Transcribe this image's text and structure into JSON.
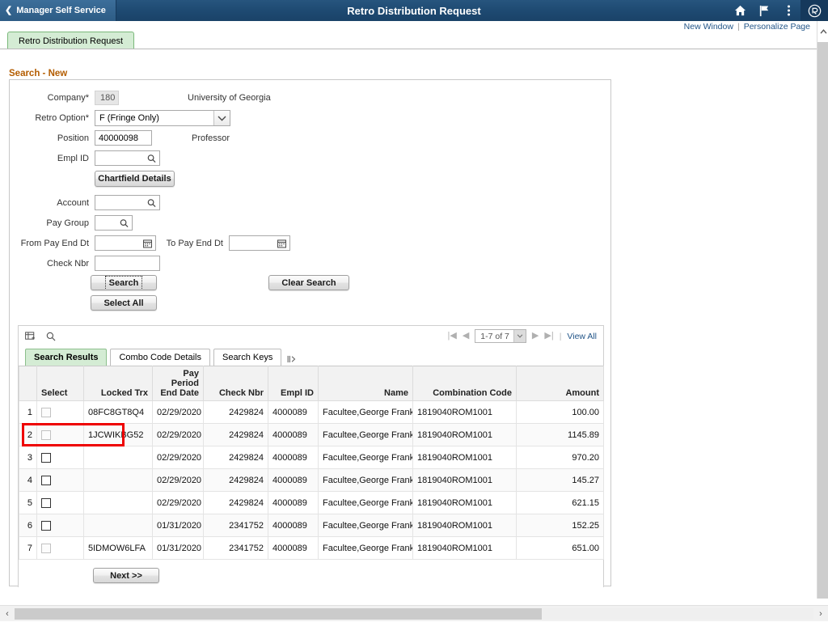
{
  "header": {
    "back_label": "Manager Self Service",
    "title": "Retro Distribution Request",
    "icons": [
      "home-icon",
      "flag-icon",
      "actions-menu-icon",
      "oracle-logo-icon"
    ]
  },
  "links": {
    "new_window": "New Window",
    "separator": "|",
    "personalize_page": "Personalize Page"
  },
  "page_tab": {
    "label": "Retro Distribution Request"
  },
  "section": {
    "title": "Search - New"
  },
  "form": {
    "company": {
      "label": "Company*",
      "value": "180",
      "description": "University of Georgia"
    },
    "retro_option": {
      "label": "Retro Option*",
      "value": "F (Fringe Only)"
    },
    "position": {
      "label": "Position",
      "value": "40000098",
      "description": "Professor"
    },
    "empl_id": {
      "label": "Empl ID",
      "value": ""
    },
    "chartfield_button": {
      "label": "Chartfield Details"
    },
    "account": {
      "label": "Account",
      "value": ""
    },
    "pay_group": {
      "label": "Pay Group",
      "value": ""
    },
    "from_pay_end_dt": {
      "label": "From Pay End Dt",
      "value": ""
    },
    "to_pay_end_dt": {
      "label": "To Pay End Dt",
      "value": ""
    },
    "check_nbr": {
      "label": "Check Nbr",
      "value": ""
    },
    "search_button": {
      "label": "Search"
    },
    "clear_search_button": {
      "label": "Clear Search"
    },
    "select_all_button": {
      "label": "Select All"
    }
  },
  "grid": {
    "toolbar_icons": [
      "personalize-grid-icon",
      "find-icon"
    ],
    "pagination": {
      "first_label": "|◀",
      "prev_label": "◀",
      "range": "1-7 of 7",
      "next_label": "▶",
      "last_label": "▶|",
      "separator": "|",
      "view_all": "View All"
    },
    "tabs": [
      {
        "label": "Search Results",
        "active": true
      },
      {
        "label": "Combo Code Details",
        "active": false
      },
      {
        "label": "Search Keys",
        "active": false
      }
    ],
    "expand_icon": "expand-tabs-icon",
    "columns": [
      "Select",
      "Locked Trx",
      "Pay Period End Date",
      "Check Nbr",
      "Empl ID",
      "Name",
      "Combination Code",
      "Amount"
    ],
    "rows": [
      {
        "num": "1",
        "selected": false,
        "checkbox_enabled": false,
        "locked_trx": "08FC8GT8Q4",
        "pay_period_end_date": "02/29/2020",
        "check_nbr": "2429824",
        "empl_id": "4000089",
        "name": "Facultee,George Frank",
        "combination_code": "1819040ROM1001",
        "amount": "100.00"
      },
      {
        "num": "2",
        "selected": false,
        "checkbox_enabled": false,
        "locked_trx": "1JCWIKBG52",
        "pay_period_end_date": "02/29/2020",
        "check_nbr": "2429824",
        "empl_id": "4000089",
        "name": "Facultee,George Frank",
        "combination_code": "1819040ROM1001",
        "amount": "1145.89"
      },
      {
        "num": "3",
        "selected": false,
        "checkbox_enabled": true,
        "locked_trx": "",
        "pay_period_end_date": "02/29/2020",
        "check_nbr": "2429824",
        "empl_id": "4000089",
        "name": "Facultee,George Frank",
        "combination_code": "1819040ROM1001",
        "amount": "970.20"
      },
      {
        "num": "4",
        "selected": false,
        "checkbox_enabled": true,
        "locked_trx": "",
        "pay_period_end_date": "02/29/2020",
        "check_nbr": "2429824",
        "empl_id": "4000089",
        "name": "Facultee,George Frank",
        "combination_code": "1819040ROM1001",
        "amount": "145.27"
      },
      {
        "num": "5",
        "selected": false,
        "checkbox_enabled": true,
        "locked_trx": "",
        "pay_period_end_date": "02/29/2020",
        "check_nbr": "2429824",
        "empl_id": "4000089",
        "name": "Facultee,George Frank",
        "combination_code": "1819040ROM1001",
        "amount": "621.15"
      },
      {
        "num": "6",
        "selected": false,
        "checkbox_enabled": true,
        "locked_trx": "",
        "pay_period_end_date": "01/31/2020",
        "check_nbr": "2341752",
        "empl_id": "4000089",
        "name": "Facultee,George Frank",
        "combination_code": "1819040ROM1001",
        "amount": "152.25"
      },
      {
        "num": "7",
        "selected": false,
        "checkbox_enabled": false,
        "locked_trx": "5IDMOW6LFA",
        "pay_period_end_date": "01/31/2020",
        "check_nbr": "2341752",
        "empl_id": "4000089",
        "name": "Facultee,George Frank",
        "combination_code": "1819040ROM1001",
        "amount": "651.00"
      }
    ],
    "next_button": {
      "label": "Next >>"
    }
  },
  "annotation": {
    "highlight_target": "Search Results",
    "color": "#ee0000"
  },
  "scrollbars": {
    "horizontal_left_arrow": "‹",
    "horizontal_right_arrow": "›"
  },
  "colors": {
    "header_blue": "#1e4a72",
    "tab_green": "#d4ecd4",
    "section_orange": "#b35c00",
    "link_blue": "#225588"
  }
}
